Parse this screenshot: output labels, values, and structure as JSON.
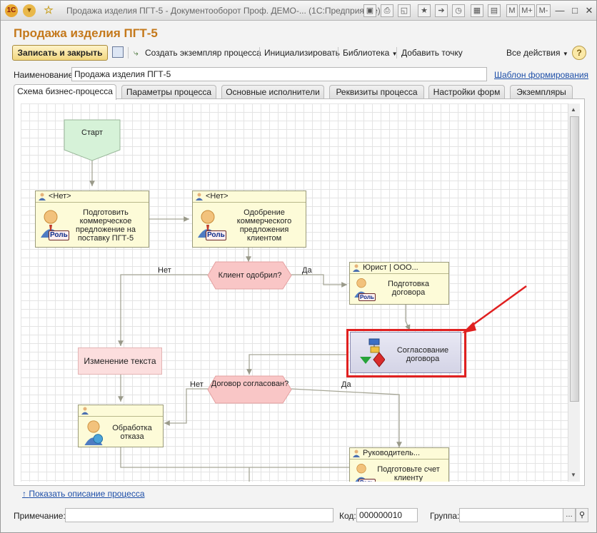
{
  "window": {
    "title": "Продажа изделия ПГТ-5 - Документооборот Проф. ДЕМО-... (1С:Предприятие)",
    "app_icon": "1C",
    "ctrl_m": "M",
    "ctrl_mplus": "M+",
    "ctrl_mminus": "M-"
  },
  "header": {
    "title": "Продажа изделия ПГТ-5"
  },
  "toolbar": {
    "save_close": "Записать и закрыть",
    "create_instance": "Создать экземпляр процесса",
    "initialize": "Инициализировать",
    "library": "Библиотека",
    "add_point": "Добавить точку",
    "all_actions": "Все действия",
    "help": "?"
  },
  "name_field": {
    "label": "Наименование:",
    "value": "Продажа изделия ПГТ-5",
    "link": "Шаблон формирования"
  },
  "tabs": [
    {
      "label": "Схема бизнес-процесса",
      "active": true
    },
    {
      "label": "Параметры процесса"
    },
    {
      "label": "Основные исполнители"
    },
    {
      "label": "Реквизиты процесса"
    },
    {
      "label": "Настройки форм"
    },
    {
      "label": "Экземпляры"
    }
  ],
  "diagram": {
    "start": "Старт",
    "task1": {
      "performer": "<Нет>",
      "text": "Подготовить коммерческое предложение на поставку ПГТ-5",
      "role": "Роль"
    },
    "task2": {
      "performer": "<Нет>",
      "text": "Одобрение коммерческого предложения клиентом",
      "role": "Роль"
    },
    "cond1": {
      "text": "Клиент одобрил?",
      "no": "Нет",
      "yes": "Да"
    },
    "task3": {
      "performer": "Юрист | ООО...",
      "text": "Подготовка договора",
      "role": "Роль"
    },
    "subprocess": {
      "text": "Согласование договора"
    },
    "edit_text": "Изменение текста",
    "cond2": {
      "text": "Договор согласован?",
      "no": "Нет",
      "yes": "Да"
    },
    "task4": {
      "performer": "",
      "text": "Обработка отказа"
    },
    "task5": {
      "performer": "Руководитель...",
      "text": "Подготовьте счет клиенту",
      "role": "Роль"
    }
  },
  "show_description": "Показать описание процесса",
  "footer": {
    "note_label": "Примечание:",
    "note_value": "",
    "code_label": "Код:",
    "code_value": "000000010",
    "group_label": "Группа:",
    "group_value": ""
  },
  "colors": {
    "accent": "#c4781a",
    "highlight": "#e02020",
    "task_fill": "#fdfbd8",
    "start_fill": "#d6f2d8",
    "condition_fill": "#f9c6c6",
    "link": "#1e4fa8"
  }
}
